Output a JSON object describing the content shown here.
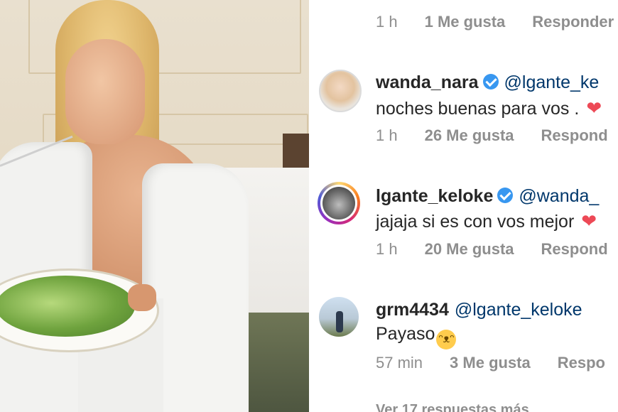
{
  "top_row": {
    "time": "1 h",
    "likes": "1 Me gusta",
    "reply": "Responder"
  },
  "comments": [
    {
      "username": "wanda_nara",
      "verified": true,
      "mention": "@lgante_ke",
      "text": "noches buenas para vos .",
      "time": "1 h",
      "likes": "26 Me gusta",
      "reply": "Respond"
    },
    {
      "username": "lgante_keloke",
      "verified": true,
      "mention": "@wanda_",
      "text": "jajaja si es con vos mejor",
      "time": "1 h",
      "likes": "20 Me gusta",
      "reply": "Respond"
    },
    {
      "username": "grm4434",
      "verified": false,
      "mention": "@lgante_keloke",
      "text": "Payaso",
      "time": "57 min",
      "likes": "3 Me gusta",
      "reply": "Respo"
    }
  ],
  "view_more": "Ver 17 respuestas más",
  "icons": {
    "verified": "verified-badge-icon",
    "heart": "red-heart-emoji",
    "laugh": "tears-of-joy-emoji"
  },
  "colors": {
    "verified": "#3897f0",
    "heart": "#ed4956",
    "muted": "#8e8e8e",
    "mention": "#00376b"
  }
}
